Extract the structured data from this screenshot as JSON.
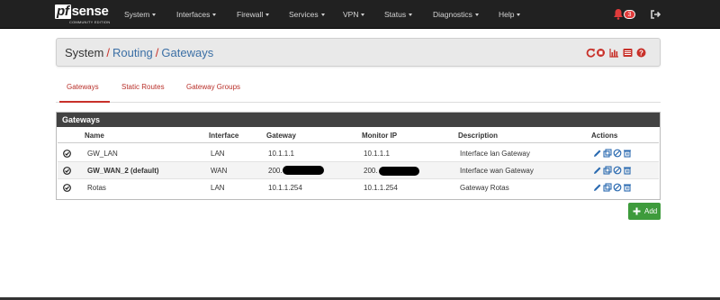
{
  "brand": {
    "name_prefix": "pf",
    "name_suffix": "sense",
    "edition": "COMMUNITY EDITION"
  },
  "nav": {
    "items": [
      {
        "label": "System"
      },
      {
        "label": "Interfaces"
      },
      {
        "label": "Firewall"
      },
      {
        "label": "Services"
      },
      {
        "label": "VPN"
      },
      {
        "label": "Status"
      },
      {
        "label": "Diagnostics"
      },
      {
        "label": "Help"
      }
    ],
    "notification_count": "3",
    "icons": {
      "notifications": "bell-icon",
      "logout": "sign-out-icon"
    }
  },
  "breadcrumb": {
    "root": "System",
    "sep": "/",
    "section": "Routing",
    "page": "Gateways",
    "icons": [
      "restart-service-icon",
      "status-stop-icon",
      "bar-chart-icon",
      "log-list-icon",
      "help-icon"
    ]
  },
  "tabs": [
    {
      "label": "Gateways",
      "active": true
    },
    {
      "label": "Static Routes",
      "active": false
    },
    {
      "label": "Gateway Groups",
      "active": false
    }
  ],
  "panel": {
    "title": "Gateways",
    "columns": {
      "name": "Name",
      "interface": "Interface",
      "gateway": "Gateway",
      "monitor_ip": "Monitor IP",
      "description": "Description",
      "actions": "Actions"
    },
    "rows": [
      {
        "name": "GW_LAN",
        "interface": "LAN",
        "gateway": "10.1.1.1",
        "monitor_ip": "10.1.1.1",
        "description": "Interface lan Gateway"
      },
      {
        "name": "GW_WAN_2 (default)",
        "interface": "WAN",
        "gateway": "200.",
        "monitor_ip": "200.",
        "description": "Interface wan Gateway"
      },
      {
        "name": "Rotas",
        "interface": "LAN",
        "gateway": "10.1.1.254",
        "monitor_ip": "10.1.1.254",
        "description": "Gateway Rotas"
      }
    ],
    "row_icons": [
      "check-circle-icon",
      "pencil-icon",
      "copy-icon",
      "disable-icon",
      "trash-icon"
    ]
  },
  "add_button": {
    "label": "Add",
    "icon": "plus-icon"
  },
  "colors": {
    "navbar": "#212121",
    "accent_red": "#c8312a",
    "link_blue": "#3b6fa5",
    "panel_heading": "#424242",
    "add_green": "#3e9b3c",
    "badge_red": "#e03b3b"
  }
}
